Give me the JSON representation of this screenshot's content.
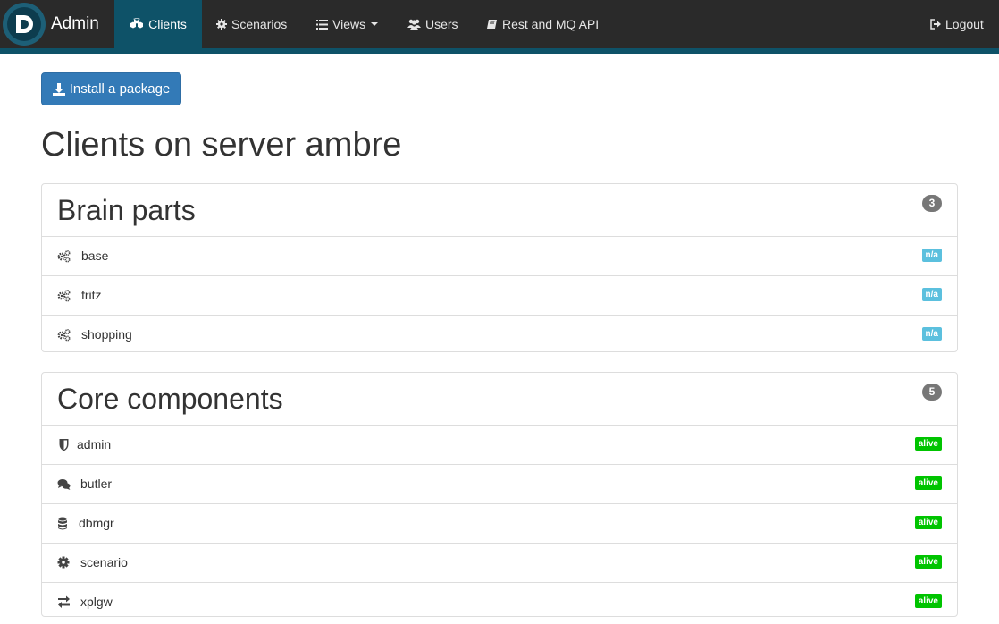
{
  "navbar": {
    "brand": "Admin",
    "items": [
      {
        "label": "Clients",
        "icon": "cubes-icon"
      },
      {
        "label": "Scenarios",
        "icon": "gear-icon"
      },
      {
        "label": "Views",
        "icon": "list-icon"
      },
      {
        "label": "Users",
        "icon": "users-icon"
      },
      {
        "label": "Rest and MQ API",
        "icon": "book-icon"
      }
    ],
    "logout": "Logout"
  },
  "install_button": "Install a package",
  "page_title": "Clients on server ambre",
  "panels": [
    {
      "title": "Brain parts",
      "count": "3",
      "rows": [
        {
          "label": "base",
          "status": "n/a",
          "icon": "cogs-icon"
        },
        {
          "label": "fritz",
          "status": "n/a",
          "icon": "cogs-icon"
        },
        {
          "label": "shopping",
          "status": "n/a",
          "icon": "cogs-icon"
        }
      ]
    },
    {
      "title": "Core components",
      "count": "5",
      "rows": [
        {
          "label": "admin",
          "status": "alive",
          "icon": "shield-icon"
        },
        {
          "label": "butler",
          "status": "alive",
          "icon": "comments-icon"
        },
        {
          "label": "dbmgr",
          "status": "alive",
          "icon": "database-icon"
        },
        {
          "label": "scenario",
          "status": "alive",
          "icon": "gear-icon"
        },
        {
          "label": "xplgw",
          "status": "alive",
          "icon": "exchange-icon"
        }
      ]
    }
  ],
  "colors": {
    "navbar": "#2a2a2a",
    "accent": "#0e5268",
    "primary_button": "#337ab7",
    "badge_na": "#5bc0de",
    "badge_alive": "#00c400"
  }
}
